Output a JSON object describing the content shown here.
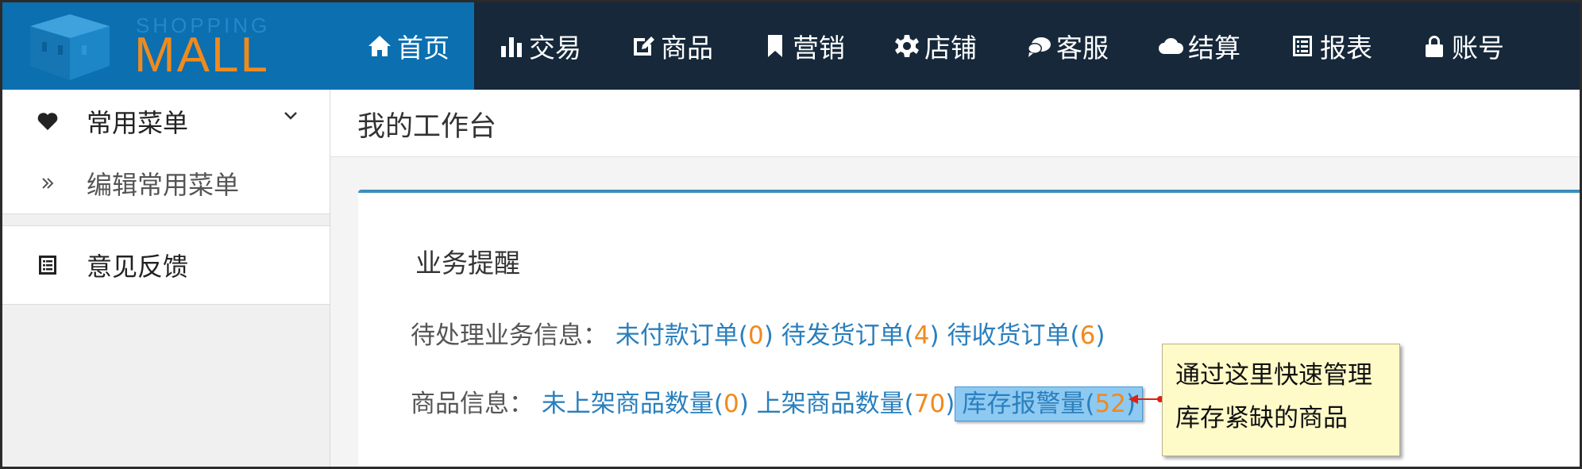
{
  "logo": {
    "small_text": "SHOPPING",
    "big_text": "MALL"
  },
  "nav": [
    {
      "label": "首页",
      "icon": "home-icon",
      "active": true
    },
    {
      "label": "交易",
      "icon": "bar-chart-icon"
    },
    {
      "label": "商品",
      "icon": "edit-icon"
    },
    {
      "label": "营销",
      "icon": "bookmark-icon"
    },
    {
      "label": "店铺",
      "icon": "gear-icon"
    },
    {
      "label": "客服",
      "icon": "chat-icon"
    },
    {
      "label": "结算",
      "icon": "cloud-icon"
    },
    {
      "label": "报表",
      "icon": "list-icon"
    },
    {
      "label": "账号",
      "icon": "lock-icon"
    }
  ],
  "sidebar": {
    "common_menu": "常用菜单",
    "edit_common_menu": "编辑常用菜单",
    "feedback": "意见反馈"
  },
  "page": {
    "title": "我的工作台"
  },
  "card": {
    "title": "业务提醒",
    "pending": {
      "label": "待处理业务信息：",
      "items": [
        {
          "label": "未付款订单",
          "count": "0"
        },
        {
          "label": "待发货订单",
          "count": "4"
        },
        {
          "label": "待收货订单",
          "count": "6"
        }
      ]
    },
    "goods": {
      "label": "商品信息：",
      "items": [
        {
          "label": "未上架商品数量",
          "count": "0"
        },
        {
          "label": "上架商品数量",
          "count": "70"
        },
        {
          "label": "库存报警量",
          "count": "52"
        }
      ]
    }
  },
  "callout": {
    "line1": "通过这里快速管理",
    "line2": "库存紧缺的商品"
  },
  "colors": {
    "nav_bg": "#16283a",
    "accent": "#0b6fb0",
    "link": "#2a7fbd",
    "count": "#f08a1d",
    "logo_orange": "#f08a1d"
  }
}
